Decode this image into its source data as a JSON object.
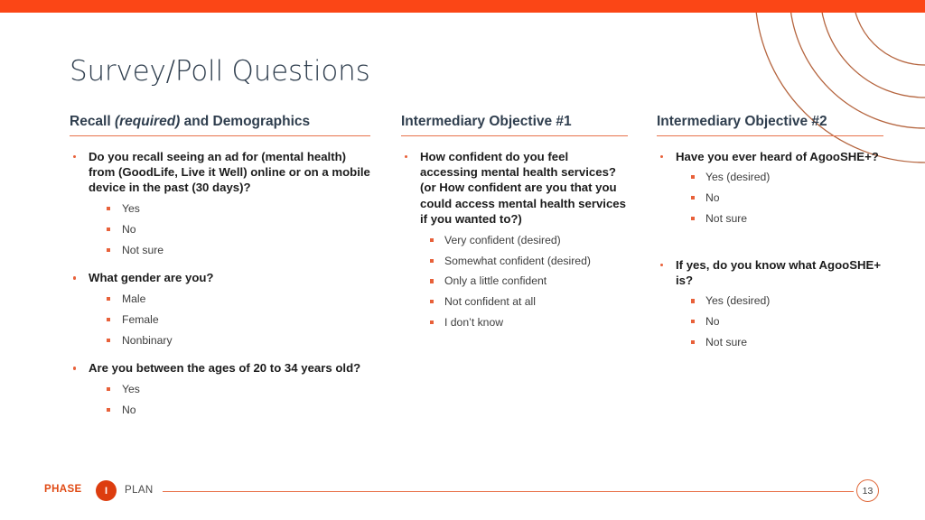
{
  "slide": {
    "title": "Survey/Poll Questions",
    "accent_color": "#fb4616",
    "rule_color": "#e8724a",
    "heading_color": "#2f3e4e",
    "arc_color": "#b5653f"
  },
  "columns": [
    {
      "head_parts": {
        "before": "Recall ",
        "italic": "(required)",
        "after": " and Demographics"
      },
      "questions": [
        {
          "text": "Do you recall seeing an ad for (mental health) from (GoodLife, Live it Well) online or on a mobile device in the past (30 days)?",
          "answers": [
            "Yes",
            "No",
            "Not sure"
          ]
        },
        {
          "text": "What gender are you?",
          "answers": [
            "Male",
            "Female",
            "Nonbinary"
          ]
        },
        {
          "text": "Are you between the ages of 20 to 34 years old?",
          "answers": [
            "Yes",
            "No"
          ]
        }
      ]
    },
    {
      "head_parts": {
        "before": "Intermediary Objective #1",
        "italic": "",
        "after": ""
      },
      "questions": [
        {
          "text": "How confident do you feel accessing mental health services? (or How confident are you that you could access mental health services if you wanted to?)",
          "answers": [
            "Very confident (desired)",
            "Somewhat confident (desired)",
            "Only a little confident",
            "Not confident at all",
            "I don’t know"
          ]
        }
      ]
    },
    {
      "head_parts": {
        "before": "Intermediary Objective #2",
        "italic": "",
        "after": ""
      },
      "questions": [
        {
          "text": "Have you ever heard of AgooSHE+?",
          "answers": [
            "Yes (desired)",
            "No",
            "Not sure"
          ]
        },
        {
          "text": "If yes, do you know what AgooSHE+ is?",
          "answers": [
            "Yes (desired)",
            "No",
            "Not sure"
          ]
        }
      ]
    }
  ],
  "footer": {
    "phase_label": "PHASE",
    "phase_number": "I",
    "phase_name": "PLAN",
    "page_number": "13"
  }
}
